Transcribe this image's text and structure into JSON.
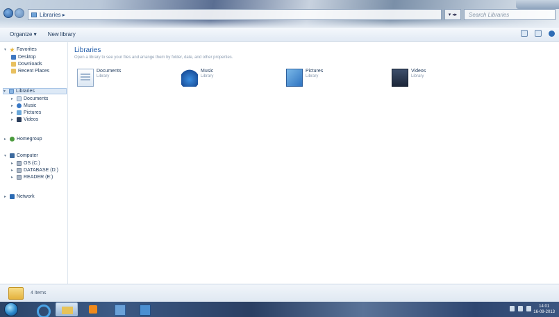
{
  "titlebar": {
    "address_path": "Libraries ▸",
    "refresh_label": "▾ ◂▸",
    "search_placeholder": "Search Libraries"
  },
  "commandbar": {
    "organize_label": "Organize ▾",
    "new_library_label": "New library"
  },
  "navigation": {
    "favorites": {
      "label": "Favorites",
      "items": [
        "Desktop",
        "Downloads",
        "Recent Places"
      ]
    },
    "libraries": {
      "label": "Libraries",
      "items": [
        "Documents",
        "Music",
        "Pictures",
        "Videos"
      ]
    },
    "homegroup": "Homegroup",
    "computer": {
      "label": "Computer",
      "items": [
        "OS (C:)",
        "DATABASE (D:)",
        "READER (E:)"
      ]
    },
    "network": "Network"
  },
  "content": {
    "title": "Libraries",
    "subtitle": "Open a library to see your files and arrange them by folder, date, and other properties.",
    "tiles": [
      {
        "name": "Documents",
        "type": "Library",
        "icon": "documents-library-icon"
      },
      {
        "name": "Music",
        "type": "Library",
        "icon": "music-library-icon"
      },
      {
        "name": "Pictures",
        "type": "Library",
        "icon": "pictures-library-icon"
      },
      {
        "name": "Videos",
        "type": "Library",
        "icon": "videos-library-icon"
      }
    ]
  },
  "details": {
    "count_text": "4 items"
  },
  "taskbar": {
    "clock_time": "14:01",
    "clock_date": "16-09-2013"
  },
  "colors": {
    "accent": "#1e5aa8",
    "text": "#1e395b",
    "selection": "#dde9f6",
    "taskbar": "#2b4468"
  }
}
